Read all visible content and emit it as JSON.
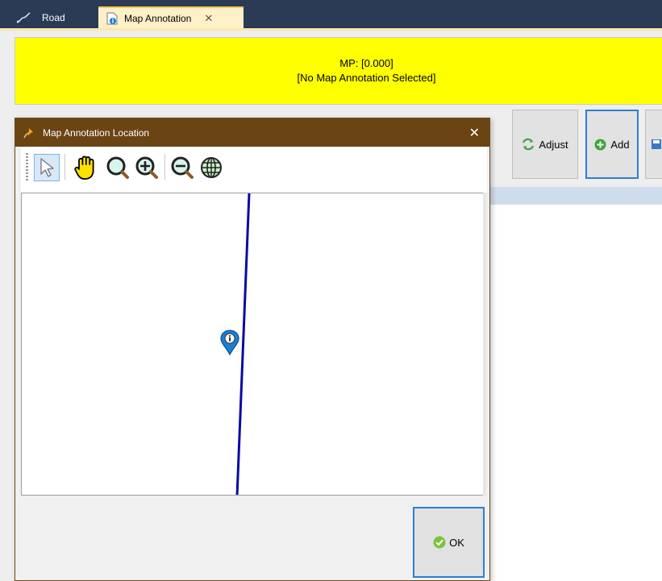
{
  "tabs": [
    {
      "label": "Road",
      "icon": "road-curve-icon"
    },
    {
      "label": "Map Annotation",
      "icon": "document-info-icon",
      "close": "✕"
    }
  ],
  "info_panel": {
    "mp_text": "MP: [0.000]",
    "selection_text": "[No Map Annotation Selected]",
    "background": "#ffff00"
  },
  "toolbar": {
    "adjust_label": "Adjust",
    "add_label": "Add"
  },
  "dialog": {
    "title": "Map Annotation Location",
    "close": "✕",
    "tools": [
      {
        "name": "select-arrow-icon",
        "active": true
      },
      {
        "name": "pan-hand-icon"
      },
      {
        "name": "zoom-extent-icon"
      },
      {
        "name": "zoom-in-icon"
      },
      {
        "name": "zoom-out-icon"
      },
      {
        "name": "globe-icon"
      }
    ],
    "ok_label": "OK"
  },
  "colors": {
    "title_bar": "#2b3a55",
    "dialog_title": "#6b4414",
    "road_line": "#0a0aa0",
    "marker": "#1a7fd6",
    "focus_border": "#2a7fd4"
  }
}
